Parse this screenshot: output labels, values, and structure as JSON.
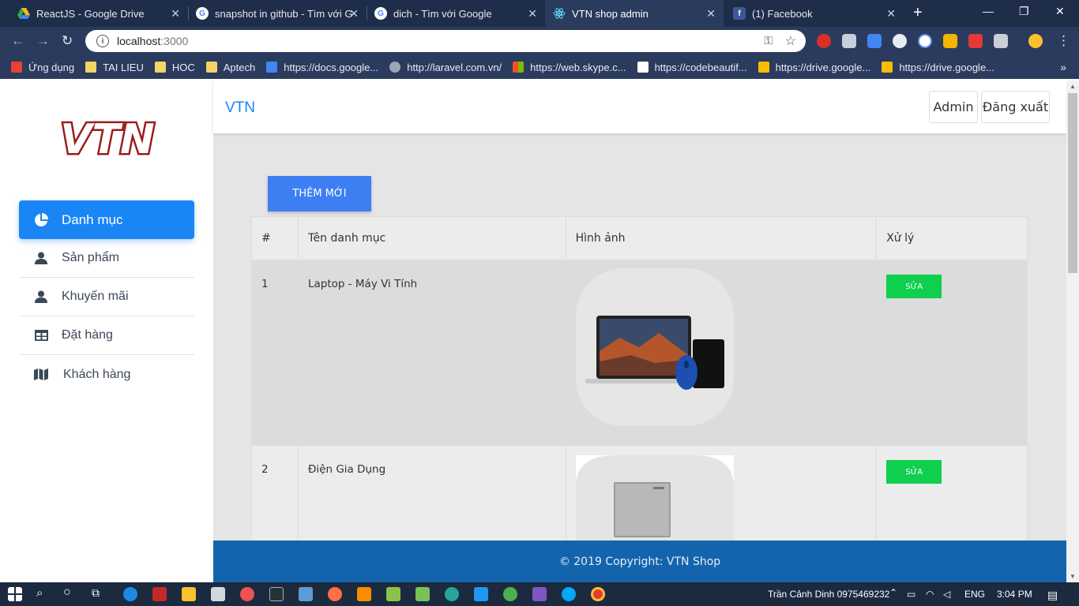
{
  "browser": {
    "tabs": [
      {
        "title": "ReactJS - Google Drive",
        "icon": "google-drive-icon",
        "color": "#34a853"
      },
      {
        "title": "snapshot in github - Tìm với G",
        "icon": "google-icon",
        "color": "#4285f4"
      },
      {
        "title": "dich - Tìm với Google",
        "icon": "google-icon",
        "color": "#4285f4"
      },
      {
        "title": "VTN shop admin",
        "icon": "react-icon",
        "color": "#61dafb"
      },
      {
        "title": "(1) Facebook",
        "icon": "facebook-icon",
        "color": "#3b5998"
      }
    ],
    "url_host": "localhost",
    "url_port": ":3000",
    "bookmarks": [
      {
        "label": "Ứng dụng",
        "color": "#e94235"
      },
      {
        "label": "TAI LIEU",
        "color": "#f6d365"
      },
      {
        "label": "HOC",
        "color": "#f6d365"
      },
      {
        "label": "Aptech",
        "color": "#f6d365"
      },
      {
        "label": "https://docs.google...",
        "color": "#4285f4"
      },
      {
        "label": "http://laravel.com.vn/",
        "color": "#9aa5b6"
      },
      {
        "label": "https://web.skype.c...",
        "color": "#f25022"
      },
      {
        "label": "https://codebeautif...",
        "color": "#ffffff"
      },
      {
        "label": "https://drive.google...",
        "color": "#fbbc04"
      },
      {
        "label": "https://drive.google...",
        "color": "#fbbc04"
      }
    ]
  },
  "app": {
    "brand": "VTN",
    "logo_text": "VTN",
    "admin_label": "Admin",
    "logout_label": "Đăng xuất",
    "menu": [
      {
        "label": "Danh mục",
        "icon": "pie-chart-icon",
        "active": true
      },
      {
        "label": "Sản phẩm",
        "icon": "user-icon",
        "active": false
      },
      {
        "label": "Khuyến mãi",
        "icon": "user-icon",
        "active": false
      },
      {
        "label": "Đặt hàng",
        "icon": "table-icon",
        "active": false
      },
      {
        "label": "Khách hàng",
        "icon": "map-icon",
        "active": false
      }
    ],
    "add_label": "THÊM MỚI",
    "table": {
      "headers": [
        "#",
        "Tên danh mục",
        "Hình ảnh",
        "Xử lý"
      ],
      "rows": [
        {
          "id": "1",
          "name": "Laptop - Máy Vi Tính",
          "image": "laptop-image",
          "action": "SỬA"
        },
        {
          "id": "2",
          "name": "Điện Gia Dụng",
          "image": "appliance-image",
          "action": "SỬA"
        }
      ]
    },
    "footer": "© 2019 Copyright: VTN Shop"
  },
  "taskbar": {
    "user": "Trần Cảnh Dinh 0975469232",
    "lang": "ENG",
    "time": "3:04 PM"
  },
  "colors": {
    "primary": "#1a86f5",
    "add_button": "#3d7ff2",
    "edit_button": "#0fcf4f",
    "footer": "#1464ad"
  }
}
